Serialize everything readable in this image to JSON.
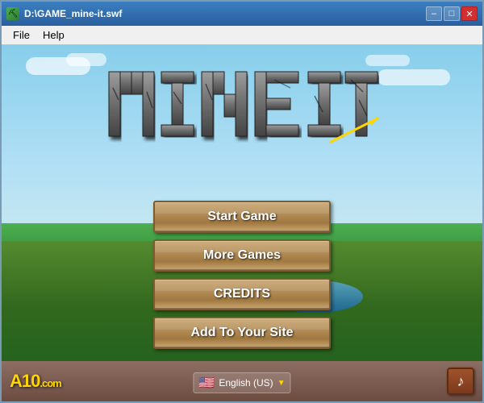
{
  "window": {
    "title": "D:\\GAME_mine-it.swf",
    "icon": "🎮"
  },
  "menu": {
    "items": [
      "File",
      "Help"
    ]
  },
  "buttons": [
    {
      "id": "start-game",
      "label": "Start Game"
    },
    {
      "id": "more-games",
      "label": "More Games"
    },
    {
      "id": "credits",
      "label": "CREDITS"
    },
    {
      "id": "add-to-site",
      "label": "Add To Your Site"
    }
  ],
  "bottom": {
    "logo": "A10",
    "logo_com": ".com",
    "lang": "English (US)",
    "music_icon": "♪"
  },
  "title_controls": {
    "minimize": "–",
    "maximize": "□",
    "close": "✕"
  }
}
